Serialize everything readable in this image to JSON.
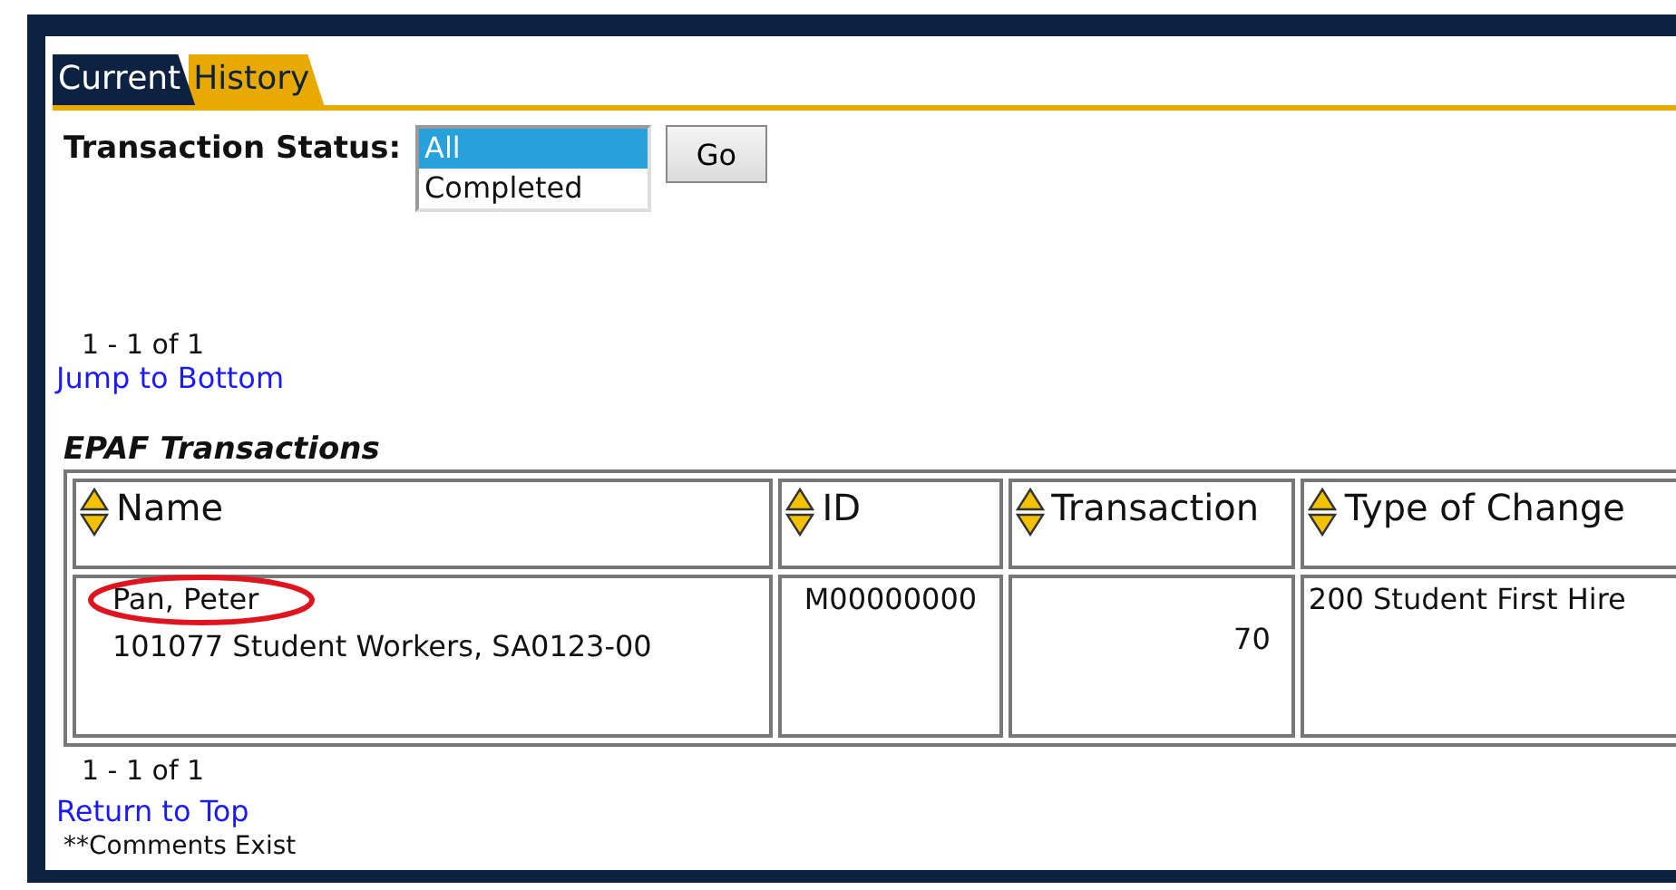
{
  "tabs": [
    {
      "label": "Current",
      "selected": true
    },
    {
      "label": "History",
      "selected": false
    }
  ],
  "filter": {
    "label": "Transaction Status:",
    "options": [
      {
        "label": "All",
        "selected": true
      },
      {
        "label": "Completed",
        "selected": false
      }
    ],
    "button": "Go"
  },
  "pagination_top": "1 - 1 of 1",
  "jump_link": "Jump to Bottom",
  "table": {
    "title": "EPAF Transactions",
    "columns": [
      "Name",
      "ID",
      "Transaction",
      "Type of Change"
    ],
    "rows": [
      {
        "name": "Pan, Peter",
        "position": "101077 Student Workers, SA0123-00",
        "id": "M00000000",
        "transaction": "70",
        "type_of_change": "200 Student First Hire",
        "circled": true
      }
    ]
  },
  "pagination_bottom": "1 - 1 of 1",
  "return_link": "Return to Top",
  "footnote": "**Comments Exist"
}
